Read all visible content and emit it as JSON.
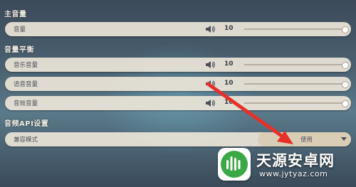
{
  "sections": {
    "master": "主音量",
    "balance": "音量平衡",
    "api": "音频API设置"
  },
  "rows": [
    {
      "label": "音量",
      "value": "10",
      "level": 1.0
    },
    {
      "label": "音乐音量",
      "value": "10",
      "level": 1.0
    },
    {
      "label": "语音音量",
      "value": "10",
      "level": 1.0
    },
    {
      "label": "音效音量",
      "value": "10",
      "level": 1.0
    }
  ],
  "api": {
    "label": "兼容模式",
    "selected": "使用"
  },
  "watermark": {
    "name": "天源安卓网",
    "url": "www.jytyaz.com"
  },
  "colors": {
    "row_bg": "#ECE5D8",
    "dropdown_bg": "#D9CDB6",
    "arrow": "#E8302A",
    "logo_green": "#3BA845"
  }
}
